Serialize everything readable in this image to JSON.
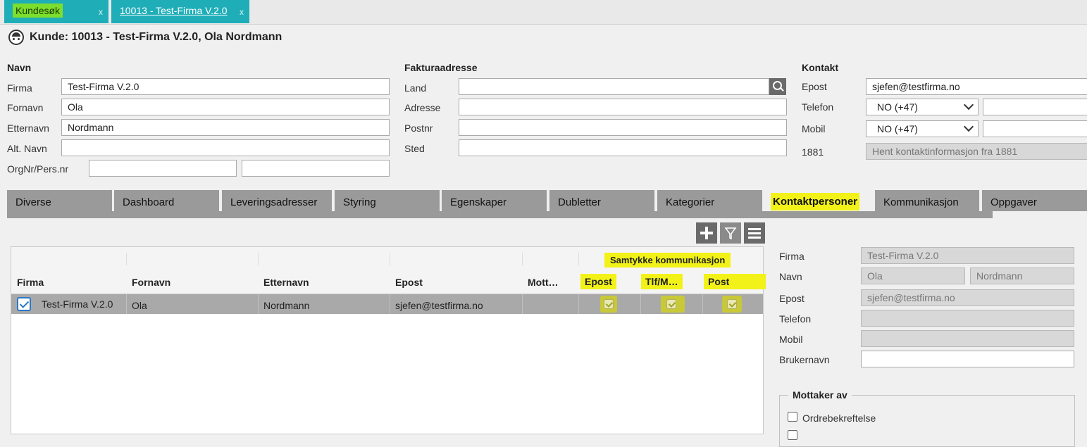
{
  "tabs": {
    "kundesok": "Kundesøk",
    "customer": "10013 - Test-Firma V.2.0",
    "close": "x"
  },
  "page_title": "Kunde: 10013 - Test-Firma V.2.0, Ola Nordmann",
  "navn": {
    "heading": "Navn",
    "firma_label": "Firma",
    "firma_value": "Test-Firma V.2.0",
    "fornavn_label": "Fornavn",
    "fornavn_value": "Ola",
    "etternavn_label": "Etternavn",
    "etternavn_value": "Nordmann",
    "altnavn_label": "Alt. Navn",
    "altnavn_value": "",
    "orgnr_label": "OrgNr/Pers.nr",
    "orgnr_value1": "",
    "orgnr_value2": ""
  },
  "faktura": {
    "heading": "Fakturaadresse",
    "land_label": "Land",
    "land_value": "",
    "adresse_label": "Adresse",
    "adresse_value": "",
    "postnr_label": "Postnr",
    "postnr_value": "",
    "sted_label": "Sted",
    "sted_value": ""
  },
  "kontakt": {
    "heading": "Kontakt",
    "epost_label": "Epost",
    "epost_value": "sjefen@testfirma.no",
    "telefon_label": "Telefon",
    "telefon_country": "NO (+47)",
    "mobil_label": "Mobil",
    "mobil_country": "NO (+47)",
    "l1881_label": "1881",
    "l1881_value": "Hent kontaktinformasjon fra 1881"
  },
  "section_tabs": [
    "Diverse",
    "Dashboard",
    "Leveringsadresser",
    "Styring",
    "Egenskaper",
    "Dubletter",
    "Kategorier",
    "Kontaktpersoner",
    "Kommunikasjon",
    "Oppgaver"
  ],
  "grid": {
    "group_header": "Samtykke kommunikasjon",
    "columns": [
      "Firma",
      "Fornavn",
      "Etternavn",
      "Epost",
      "Mott…",
      "Epost",
      "Tlf/M…",
      "Post"
    ],
    "rows": [
      {
        "firma": "Test-Firma V.2.0",
        "fornavn": "Ola",
        "etternavn": "Nordmann",
        "epost": "sjefen@testfirma.no",
        "mottaker": "",
        "selected": true,
        "samtykke_epost": true,
        "samtykke_tlf": true,
        "samtykke_post": true
      }
    ]
  },
  "detail": {
    "firma_label": "Firma",
    "firma_value": "Test-Firma V.2.0",
    "navn_label": "Navn",
    "fornavn_value": "Ola",
    "etternavn_value": "Nordmann",
    "epost_label": "Epost",
    "epost_value": "sjefen@testfirma.no",
    "telefon_label": "Telefon",
    "telefon_value": "",
    "mobil_label": "Mobil",
    "mobil_value": "",
    "brukernavn_label": "Brukernavn",
    "brukernavn_value": "",
    "mottaker_legend": "Mottaker av",
    "ordrebekreftelse": "Ordrebekreftelse"
  }
}
